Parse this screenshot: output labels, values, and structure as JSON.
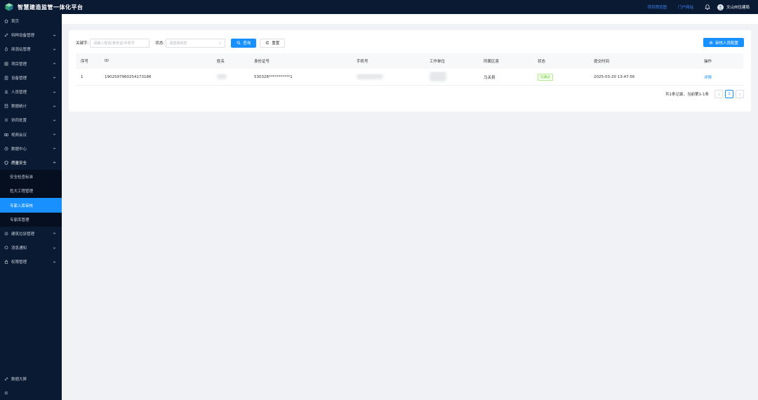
{
  "app": {
    "title": "智慧建造监管一体化平台"
  },
  "header": {
    "links": [
      "项目预览图",
      "门户网站"
    ],
    "user": "文山州住建局"
  },
  "sidebar": {
    "items": [
      {
        "label": "首页",
        "icon": "home-icon",
        "has_children": false
      },
      {
        "label": "特种设备管理",
        "icon": "link-icon",
        "has_children": true
      },
      {
        "label": "商混站管理",
        "icon": "drop-icon",
        "has_children": true
      },
      {
        "label": "项目管理",
        "icon": "grid-icon",
        "has_children": true
      },
      {
        "label": "设备管理",
        "icon": "device-icon",
        "has_children": true
      },
      {
        "label": "人员管理",
        "icon": "user-icon",
        "has_children": true
      },
      {
        "label": "数据统计",
        "icon": "doc-icon",
        "has_children": true
      },
      {
        "label": "协同处置",
        "icon": "list-icon",
        "has_children": true
      },
      {
        "label": "视频会议",
        "icon": "camera-icon",
        "has_children": true
      },
      {
        "label": "数据中心",
        "icon": "clock-icon",
        "has_children": true
      },
      {
        "label": "质量安全",
        "icon": "shield-icon",
        "has_children": true,
        "open": true
      }
    ],
    "sub_items": [
      {
        "label": "安全检查标准",
        "active": false
      },
      {
        "label": "危大工程管理",
        "active": false
      },
      {
        "label": "专家入库审核",
        "active": true
      },
      {
        "label": "专家库管理",
        "active": false
      }
    ],
    "items_after": [
      {
        "label": "建筑垃圾管理",
        "icon": "recycle-icon",
        "has_children": true
      },
      {
        "label": "消息通知",
        "icon": "message-icon",
        "has_children": true
      },
      {
        "label": "权限管理",
        "icon": "lock-icon",
        "has_children": true
      }
    ],
    "bottom": {
      "label": "数据大屏"
    }
  },
  "search": {
    "keyword_label": "关键字:",
    "keyword_placeholder": "请输入姓名/身份证/手机号",
    "status_label": "状态:",
    "status_placeholder": "请选择状态",
    "query_label": "查询",
    "reset_label": "重置",
    "config_label": "审核人员配置"
  },
  "table": {
    "columns": [
      "序号",
      "ID",
      "姓名",
      "身份证号",
      "手机号",
      "工作单位",
      "所属区县",
      "状态",
      "提交时间",
      "操作"
    ],
    "rows": [
      {
        "index": "1",
        "id": "1902597960254173186",
        "name": "",
        "id_card": "530328***********1",
        "phone": "",
        "unit": "",
        "county": "马关县",
        "status": "已通过",
        "submit_time": "2025-03-20 13:47:56",
        "action": "详情"
      }
    ]
  },
  "pagination": {
    "summary": "共1条记录，当前第1-1条",
    "current_page": "1"
  },
  "colors": {
    "primary": "#1890ff",
    "sidebar_bg": "#0b1a33",
    "success": "#52c41a"
  }
}
